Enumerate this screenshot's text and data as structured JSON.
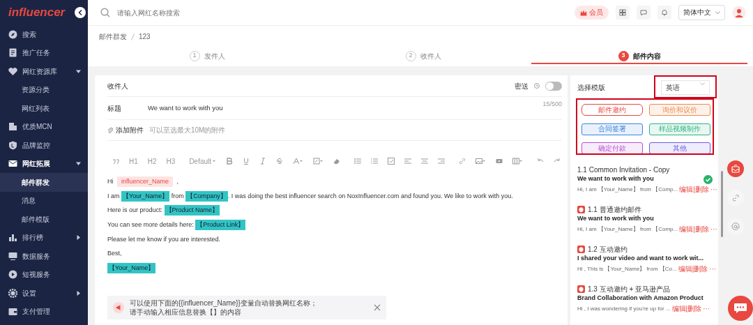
{
  "sidebar": {
    "logo": "influencer",
    "items": [
      {
        "label": "搜索"
      },
      {
        "label": "推广任务"
      },
      {
        "label": "网红资源库",
        "expanded": true,
        "children": [
          {
            "label": "资源分类",
            "selected": false
          },
          {
            "label": "网红列表",
            "selected": false
          }
        ]
      },
      {
        "label": "优质MCN"
      },
      {
        "label": "品牌监控"
      },
      {
        "label": "网红拓展",
        "expanded": true,
        "children": [
          {
            "label": "邮件群发",
            "selected": true
          },
          {
            "label": "消息",
            "selected": false
          },
          {
            "label": "邮件模版",
            "selected": false
          }
        ]
      },
      {
        "label": "排行榜",
        "expanded": false
      },
      {
        "label": "数据服务"
      },
      {
        "label": "短视服务"
      },
      {
        "label": "设置",
        "expanded": false
      },
      {
        "label": "支付管理"
      }
    ]
  },
  "topbar": {
    "search": {
      "placeholder": "请输入网红名称搜索"
    },
    "vip_label": "会员",
    "language": "简体中文"
  },
  "breadcrumb": [
    "邮件群发",
    "123"
  ],
  "steps": [
    {
      "number": "1",
      "label": "发件人",
      "selected": false
    },
    {
      "number": "2",
      "label": "收件人",
      "selected": false
    },
    {
      "number": "3",
      "label": "邮件内容",
      "selected": true
    }
  ],
  "compose": {
    "recipients_label": "收件人",
    "bcc_label": "密送",
    "bcc_on": false,
    "subject_label": "标题",
    "subject": "We want to work with you",
    "subject_count": "15/500",
    "attachment_label": "添加附件",
    "attachment_hint": "可以至选最大10M的附件",
    "toolbar_labels": [
      "H1",
      "H2",
      "H3",
      "Default"
    ],
    "body": [
      [
        {
          "kind": "text",
          "text": "Hi "
        },
        {
          "kind": "variable",
          "text": "influencer_Name"
        },
        {
          "kind": "text",
          "text": " ,"
        }
      ],
      [
        {
          "kind": "text",
          "text": "I am "
        },
        {
          "kind": "placeholder",
          "text": "【Your_Name】"
        },
        {
          "kind": "text",
          "text": " from "
        },
        {
          "kind": "placeholder",
          "text": "【Company】"
        },
        {
          "kind": "text",
          "text": ". I was doing the best influencer search on NoxInfluencer.com and found you. We like to work with you."
        }
      ],
      [
        {
          "kind": "text",
          "text": "Here is our product: "
        },
        {
          "kind": "placeholder",
          "text": "【Product Name】"
        }
      ],
      [
        {
          "kind": "text",
          "text": "You can see more details here: "
        },
        {
          "kind": "placeholder",
          "text": "【Product Link】"
        }
      ],
      [
        {
          "kind": "text",
          "text": "Please let me know if you are interested."
        }
      ],
      [
        {
          "kind": "text",
          "text": "Best,"
        }
      ],
      [
        {
          "kind": "placeholder",
          "text": "【Your_Name】"
        }
      ]
    ],
    "notice": [
      "可以使用下面的{{influencer_Name}}变量自动替换网红名称；",
      "请手动输入相应信息替换【】的内容"
    ]
  },
  "templates": {
    "title": "选择模版",
    "language": "英语",
    "categories": [
      {
        "label": "邮件邀约",
        "color": "#e8483f",
        "selected": true
      },
      {
        "label": "询价和议价",
        "color": "#f08a4b",
        "selected": false
      },
      {
        "label": "合同签署",
        "color": "#3b82e0",
        "selected": false
      },
      {
        "label": "样品视频制作",
        "color": "#2bb383",
        "selected": false
      },
      {
        "label": "确定付款",
        "color": "#b84fd6",
        "selected": false
      },
      {
        "label": "其他",
        "color": "#6a5ae0",
        "selected": false
      }
    ],
    "items": [
      {
        "kind": "custom",
        "title": "1.1 Common Invitation - Copy",
        "subject": "We want to work with you",
        "preview": "Hi, I am 【Your_Name】 from 【Comp...",
        "actions": "编辑|删除",
        "more": "···",
        "selected": true
      },
      {
        "kind": "official",
        "title": "1.1 普通邀约邮件",
        "subject": "We want to work with you",
        "preview": "Hi, I am 【Your_Name】 from 【Comp...",
        "actions": "编辑|删除",
        "more": "···",
        "selected": false
      },
      {
        "kind": "official",
        "title": "1.2 互动邀约",
        "subject": "I shared your video and want to work wit...",
        "preview": "Hi , This is 【Your_Name】 from 【Co...",
        "actions": "编辑|删除",
        "more": "···",
        "selected": false
      },
      {
        "kind": "official",
        "title": "1.3 互动邀约 + 亚马逊产品",
        "subject": "Brand Collaboration with Amazon Product",
        "preview": "Hi , I was wondering if you're up for ...",
        "actions": "编辑|删除",
        "more": "···",
        "selected": false
      }
    ]
  }
}
